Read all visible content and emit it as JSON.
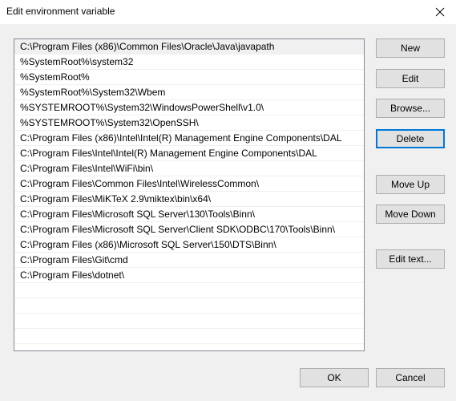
{
  "window": {
    "title": "Edit environment variable"
  },
  "list": {
    "items": [
      "C:\\Program Files (x86)\\Common Files\\Oracle\\Java\\javapath",
      "%SystemRoot%\\system32",
      "%SystemRoot%",
      "%SystemRoot%\\System32\\Wbem",
      "%SYSTEMROOT%\\System32\\WindowsPowerShell\\v1.0\\",
      "%SYSTEMROOT%\\System32\\OpenSSH\\",
      "C:\\Program Files (x86)\\Intel\\Intel(R) Management Engine Components\\DAL",
      "C:\\Program Files\\Intel\\Intel(R) Management Engine Components\\DAL",
      "C:\\Program Files\\Intel\\WiFi\\bin\\",
      "C:\\Program Files\\Common Files\\Intel\\WirelessCommon\\",
      "C:\\Program Files\\MiKTeX 2.9\\miktex\\bin\\x64\\",
      "C:\\Program Files\\Microsoft SQL Server\\130\\Tools\\Binn\\",
      "C:\\Program Files\\Microsoft SQL Server\\Client SDK\\ODBC\\170\\Tools\\Binn\\",
      "C:\\Program Files (x86)\\Microsoft SQL Server\\150\\DTS\\Binn\\",
      "C:\\Program Files\\Git\\cmd",
      "C:\\Program Files\\dotnet\\"
    ],
    "selected_index": 0
  },
  "buttons": {
    "new": "New",
    "edit": "Edit",
    "browse": "Browse...",
    "delete": "Delete",
    "move_up": "Move Up",
    "move_down": "Move Down",
    "edit_text": "Edit text...",
    "ok": "OK",
    "cancel": "Cancel"
  },
  "colors": {
    "focus_border": "#0078d7",
    "button_face": "#e1e1e1",
    "selection": "#f0f0f0"
  },
  "icons": {
    "close": "close-icon"
  }
}
